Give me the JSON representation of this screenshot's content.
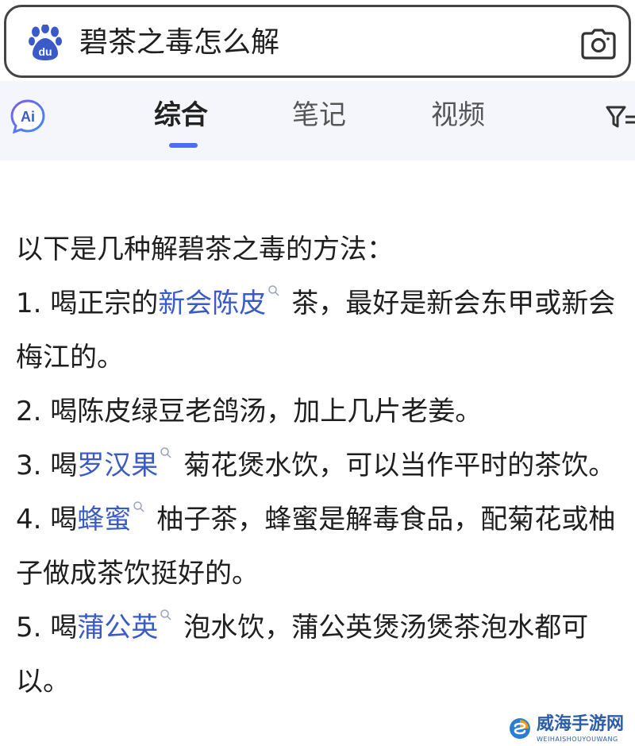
{
  "search": {
    "query": "碧茶之毒怎么解",
    "logo_text": "du"
  },
  "tabs": {
    "ai_label": "Ai",
    "items": [
      {
        "label": "综合",
        "active": true
      },
      {
        "label": "笔记",
        "active": false
      },
      {
        "label": "视频",
        "active": false
      }
    ]
  },
  "answer": {
    "intro": "以下是几种解碧茶之毒的方法：",
    "items": [
      {
        "prefix": "1. 喝正宗的",
        "keyword": "新会陈皮",
        "suffix": "茶，最好是新会东甲或新会梅江的。"
      },
      {
        "prefix": "2. 喝陈皮绿豆老鸽汤，加上几片老姜。",
        "keyword": "",
        "suffix": ""
      },
      {
        "prefix": "3. 喝",
        "keyword": "罗汉果",
        "suffix": "菊花煲水饮，可以当作平时的茶饮。"
      },
      {
        "prefix": "4. 喝",
        "keyword": "蜂蜜",
        "suffix": "柚子茶，蜂蜜是解毒食品，配菊花或柚子做成茶饮挺好的。"
      },
      {
        "prefix": "5. 喝",
        "keyword": "蒲公英",
        "suffix": "泡水饮，蒲公英煲汤煲茶泡水都可以。"
      }
    ]
  },
  "watermark": {
    "title": "威海手游网",
    "subtitle": "WEIHAISHOUYOUWANG"
  },
  "colors": {
    "accent": "#4e6ef2",
    "keyword": "#3a5bc7",
    "tab_background": "#f5f6fb"
  }
}
